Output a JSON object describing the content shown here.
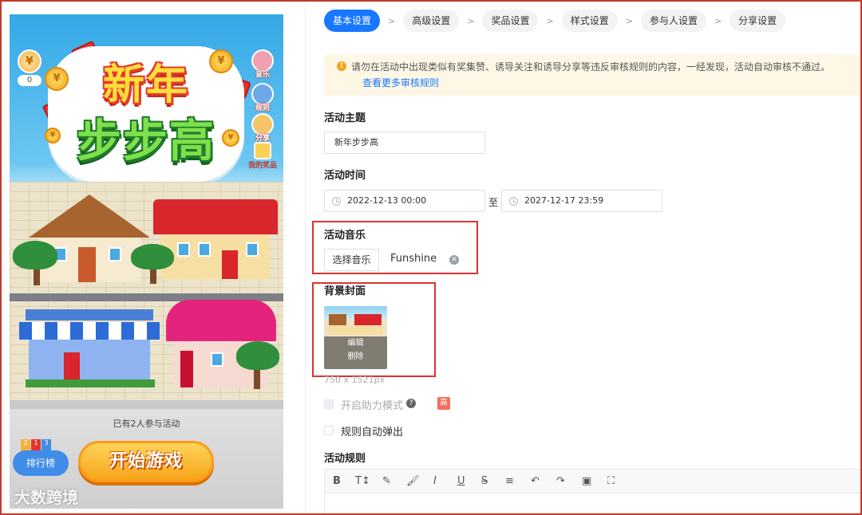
{
  "preview": {
    "title_line1": "新年",
    "title_line2": "步步高",
    "score_value": "0",
    "side_buttons": [
      "音乐",
      "规则",
      "分享",
      "我的奖品"
    ],
    "participants_text": "已有2人参与活动",
    "rank_label": "排行榜",
    "rank_numbers": [
      "2",
      "1",
      "3"
    ],
    "start_label": "开始游戏",
    "watermark": "大数跨境"
  },
  "steps": [
    {
      "label": "基本设置",
      "active": true
    },
    {
      "label": "高级设置",
      "active": false
    },
    {
      "label": "奖品设置",
      "active": false
    },
    {
      "label": "样式设置",
      "active": false
    },
    {
      "label": "参与人设置",
      "active": false
    },
    {
      "label": "分享设置",
      "active": false
    }
  ],
  "step_separator": ">",
  "notice": {
    "text": "请勿在活动中出现类似有奖集赞、诱导关注和诱导分享等违反审核规则的内容，一经发现，活动自动审核不通过。",
    "link": "查看更多审核规则"
  },
  "form": {
    "theme_label": "活动主题",
    "theme_value": "新年步步高",
    "time_label": "活动时间",
    "start_time": "2022-12-13 00:00",
    "to_text": "至",
    "end_time": "2027-12-17 23:59",
    "music_label": "活动音乐",
    "music_button": "选择音乐",
    "music_name": "Funshine",
    "cover_label": "背景封面",
    "cover_edit": "编辑",
    "cover_delete": "删除",
    "cover_size": "750 x 1521px",
    "assist_mode_label": "开启助力模式",
    "assist_badge": "高",
    "rules_popup_label": "规则自动弹出",
    "rules_label": "活动规则"
  },
  "editor_toolbar": [
    "B",
    "T↕",
    "✎",
    "🖌",
    "I",
    "U",
    "S",
    "≡",
    "↶",
    "↷",
    "▣",
    "⛶"
  ],
  "colors": {
    "primary": "#1677ff",
    "highlight_box": "#e03131",
    "notice_bg": "#fff7e6",
    "warning": "#f7a21a"
  }
}
